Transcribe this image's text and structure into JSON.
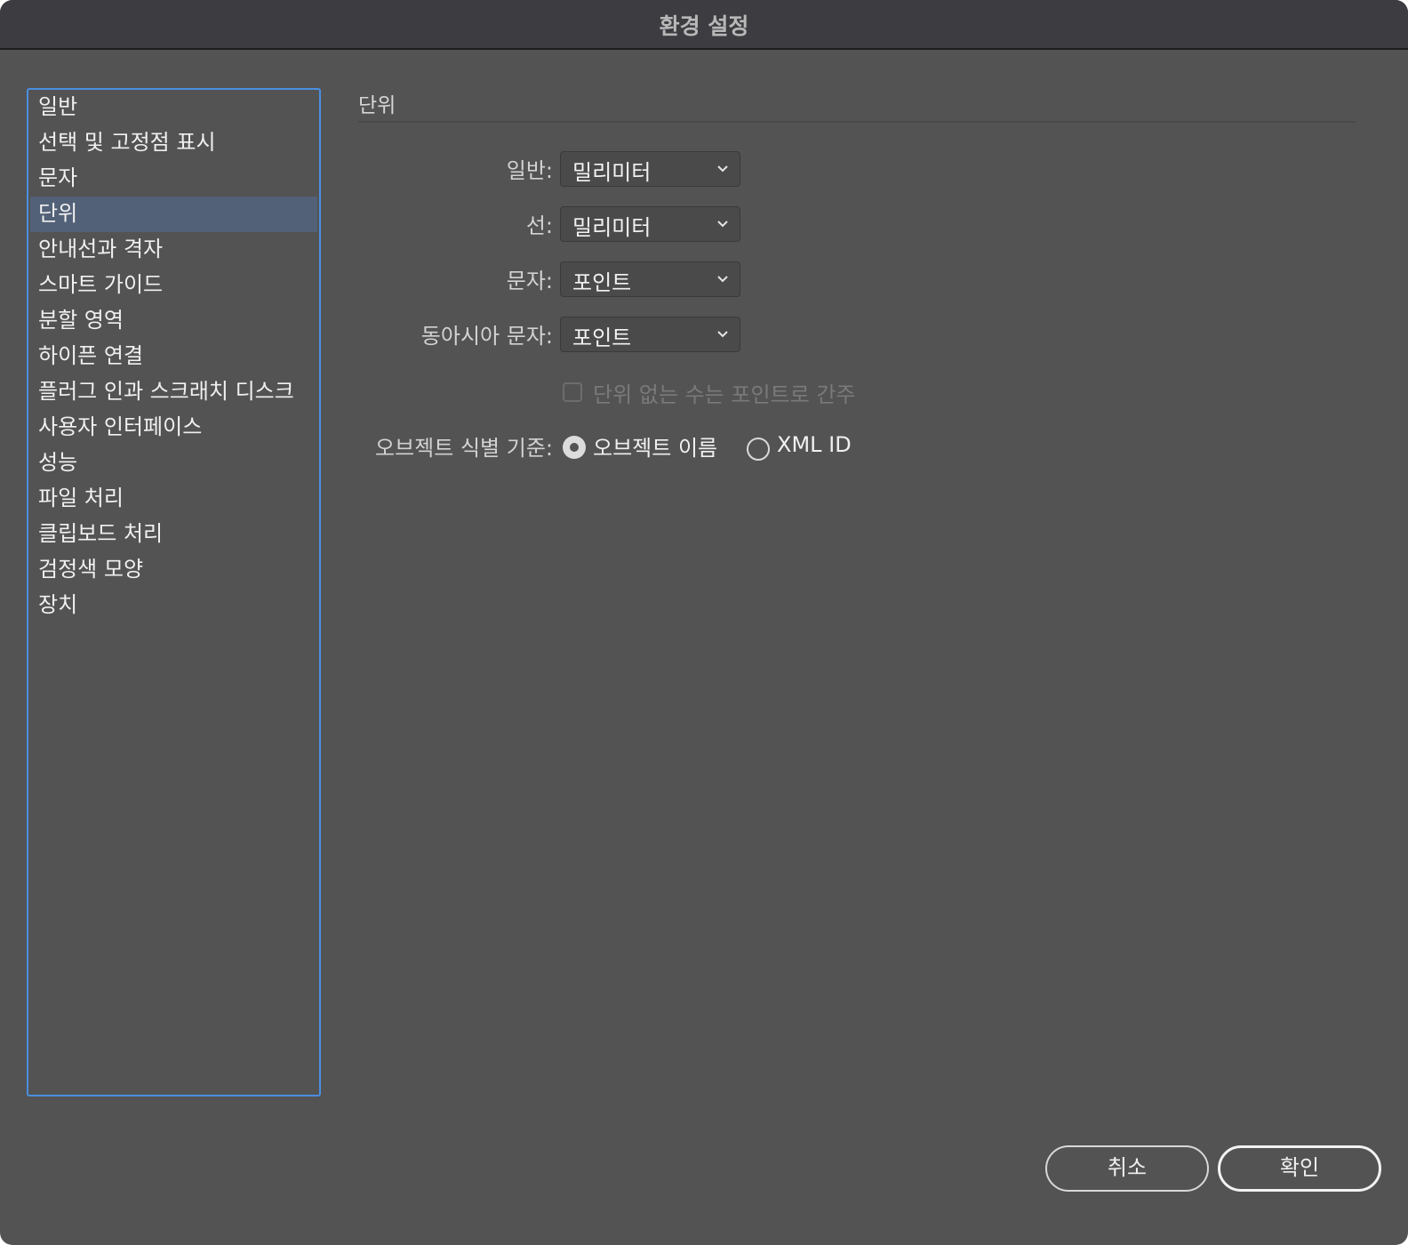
{
  "window": {
    "title": "환경 설정"
  },
  "sidebar": {
    "items": [
      {
        "label": "일반",
        "selected": false
      },
      {
        "label": "선택 및 고정점 표시",
        "selected": false
      },
      {
        "label": "문자",
        "selected": false
      },
      {
        "label": "단위",
        "selected": true
      },
      {
        "label": "안내선과 격자",
        "selected": false
      },
      {
        "label": "스마트 가이드",
        "selected": false
      },
      {
        "label": "분할 영역",
        "selected": false
      },
      {
        "label": "하이픈 연결",
        "selected": false
      },
      {
        "label": "플러그 인과 스크래치 디스크",
        "selected": false
      },
      {
        "label": "사용자 인터페이스",
        "selected": false
      },
      {
        "label": "성능",
        "selected": false
      },
      {
        "label": "파일 처리",
        "selected": false
      },
      {
        "label": "클립보드 처리",
        "selected": false
      },
      {
        "label": "검정색 모양",
        "selected": false
      },
      {
        "label": "장치",
        "selected": false
      }
    ]
  },
  "units": {
    "section_title": "단위",
    "general": {
      "label": "일반:",
      "value": "밀리미터"
    },
    "stroke": {
      "label": "선:",
      "value": "밀리미터"
    },
    "type": {
      "label": "문자:",
      "value": "포인트"
    },
    "asian_type": {
      "label": "동아시아 문자:",
      "value": "포인트"
    },
    "unitless_checkbox": {
      "label": "단위 없는 수는 포인트로 간주",
      "checked": false,
      "enabled": false
    },
    "identify_by": {
      "label": "오브젝트 식별 기준:",
      "options": [
        {
          "label": "오브젝트 이름",
          "selected": true
        },
        {
          "label": "XML ID",
          "selected": false
        }
      ]
    }
  },
  "footer": {
    "cancel_label": "취소",
    "ok_label": "확인"
  },
  "colors": {
    "panel_bg": "#535353",
    "titlebar_bg": "#3d3c41",
    "selection_bg": "#536178",
    "focus_border": "#4a8fe0"
  }
}
